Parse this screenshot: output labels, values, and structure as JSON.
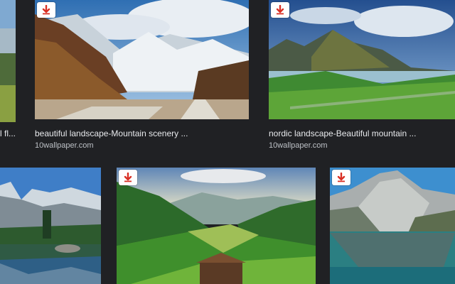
{
  "row1": {
    "left_caption": "l fl...",
    "card1": {
      "title": "beautiful landscape-Mountain scenery ...",
      "source": "10wallpaper.com"
    },
    "card2": {
      "title": "nordic landscape-Beautiful mountain ...",
      "source": "10wallpaper.com"
    }
  },
  "colors": {
    "background": "#202124",
    "download_badge": "#d93025",
    "caption": "#e8eaed",
    "source": "#bdc1c6"
  },
  "icons": {
    "download": "download-arrow-icon"
  }
}
